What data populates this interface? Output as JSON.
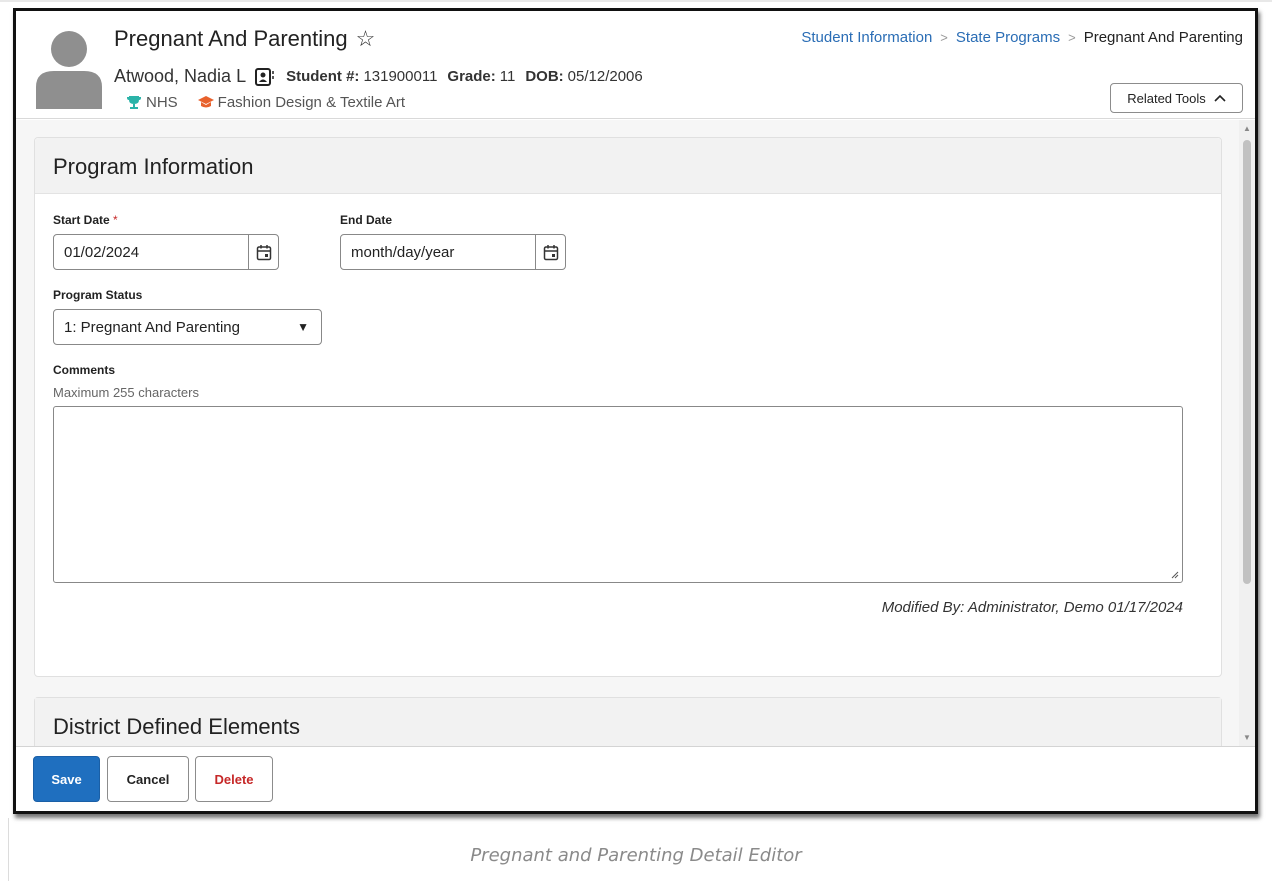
{
  "header": {
    "title": "Pregnant And Parenting",
    "student_name": "Atwood, Nadia L",
    "student_num_label": "Student #:",
    "student_num": "131900011",
    "grade_label": "Grade:",
    "grade": "11",
    "dob_label": "DOB:",
    "dob": "05/12/2006",
    "tags": [
      {
        "label": "NHS",
        "icon": "trophy-icon",
        "color": "#2bb3a8"
      },
      {
        "label": "Fashion Design & Textile Art",
        "icon": "graduation-cap-icon",
        "color": "#e8612c"
      }
    ],
    "breadcrumb": [
      "Student Information",
      "State Programs",
      "Pregnant And Parenting"
    ],
    "related_tools_label": "Related Tools"
  },
  "program_info": {
    "section_title": "Program Information",
    "start_date_label": "Start Date",
    "start_date_value": "01/02/2024",
    "end_date_label": "End Date",
    "end_date_placeholder": "month/day/year",
    "program_status_label": "Program Status",
    "program_status_value": "1: Pregnant And Parenting",
    "comments_label": "Comments",
    "comments_help": "Maximum 255 characters",
    "comments_value": "",
    "modified_by": "Modified By: Administrator, Demo 01/17/2024"
  },
  "district_section": {
    "section_title": "District Defined Elements"
  },
  "actions": {
    "save_label": "Save",
    "cancel_label": "Cancel",
    "delete_label": "Delete"
  },
  "caption": "Pregnant and Parenting Detail Editor",
  "colors": {
    "accent": "#1f6fbf",
    "link": "#2a6db5",
    "danger": "#c62828"
  }
}
